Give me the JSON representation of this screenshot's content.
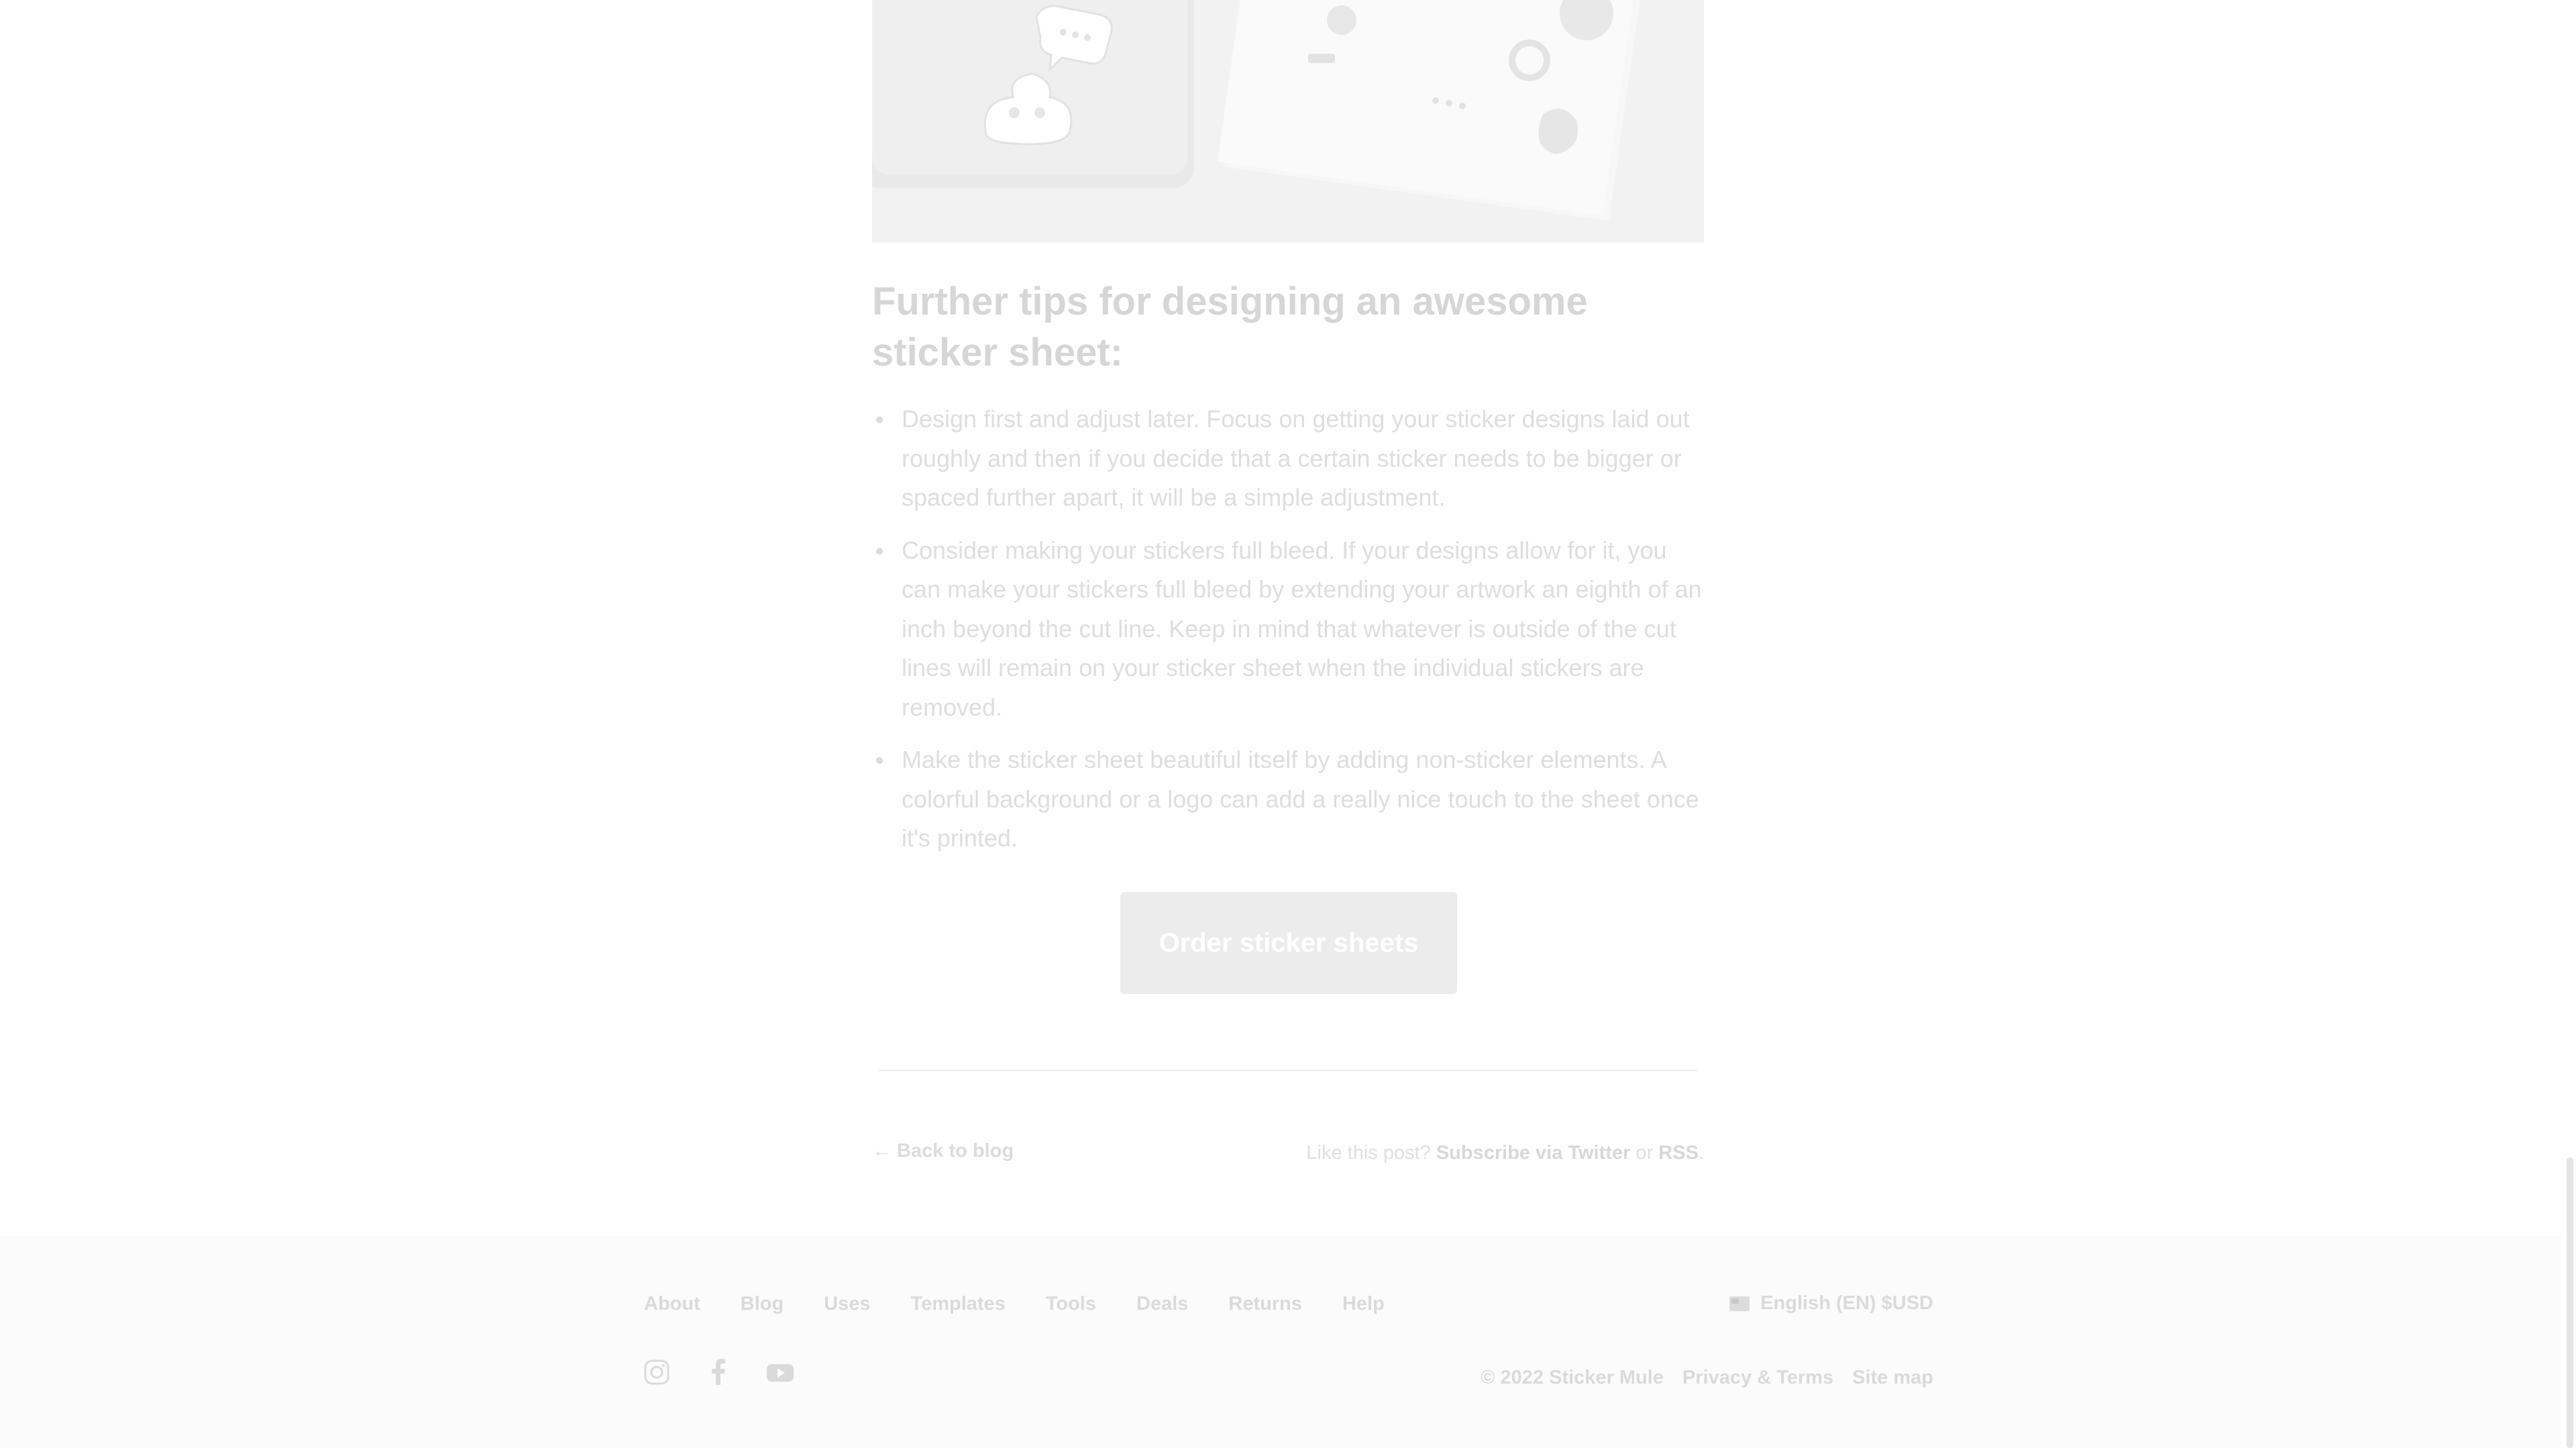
{
  "article": {
    "heading": "Further tips for designing an awesome sticker sheet:",
    "tips": [
      "Design first and adjust later. Focus on getting your sticker designs laid out roughly and then if you decide that a certain sticker needs to be bigger or spaced further apart, it will be a simple adjustment.",
      "Consider making your stickers full bleed. If your designs allow for it, you can make your stickers full bleed by extending your artwork an eighth of an inch beyond the cut line. Keep in mind that whatever is outside of the cut lines will remain on your sticker sheet when the individual stickers are removed.",
      "Make the sticker sheet beautiful itself by adding non-sticker elements. A colorful background or a logo can add a really nice touch to the sheet once it's printed."
    ],
    "cta_label": "Order sticker sheets"
  },
  "post_nav": {
    "back_label": "← Back to blog",
    "subscribe_prefix": "Like this post? ",
    "subscribe_text": "Subscribe via ",
    "twitter_label": "Twitter",
    "or_text": " or ",
    "rss_label": "RSS",
    "period": "."
  },
  "footer": {
    "nav": [
      "About",
      "Blog",
      "Uses",
      "Templates",
      "Tools",
      "Deals",
      "Returns",
      "Help"
    ],
    "language": "English (EN) $USD",
    "copyright": "© 2022 Sticker Mule",
    "privacy_label": "Privacy & Terms",
    "sitemap_label": "Site map",
    "social_icons": [
      "instagram-icon",
      "facebook-icon",
      "youtube-icon"
    ]
  },
  "colors": {
    "page_background": "#ffffff",
    "footer_background": "#fbfbfb",
    "faded_text": "#dadada"
  }
}
